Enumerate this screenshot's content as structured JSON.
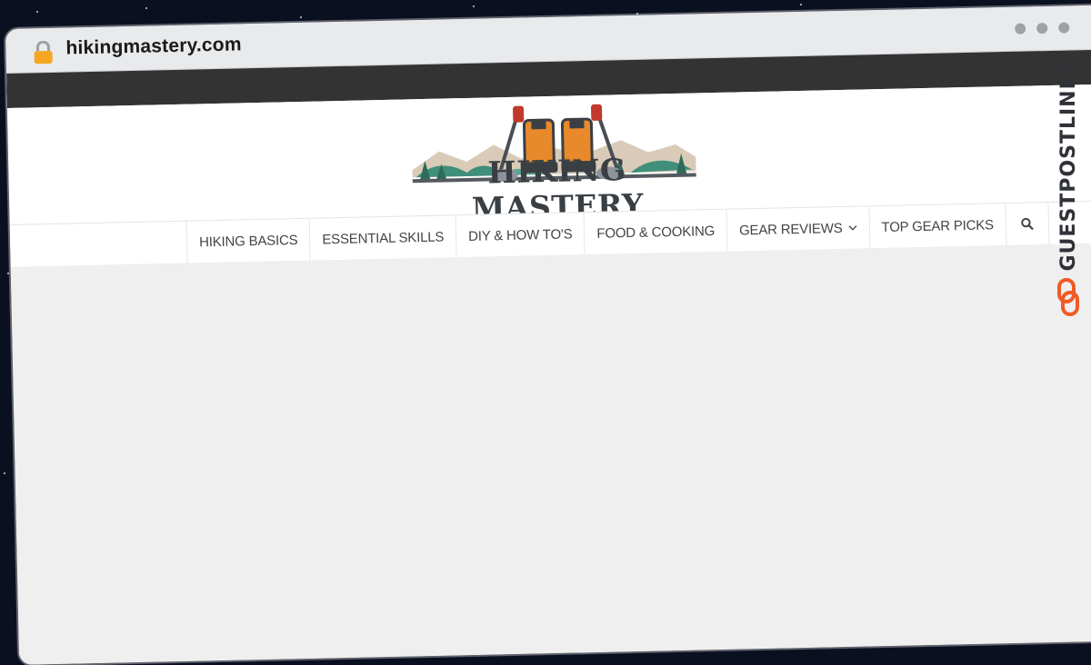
{
  "browser": {
    "url": "hikingmastery.com"
  },
  "site": {
    "logo_text": "HIKING MASTERY"
  },
  "nav": {
    "items": [
      {
        "label": "HIKING BASICS"
      },
      {
        "label": "ESSENTIAL SKILLS"
      },
      {
        "label": "DIY & HOW TO'S"
      },
      {
        "label": "FOOD & COOKING"
      },
      {
        "label": "GEAR REVIEWS"
      },
      {
        "label": "TOP GEAR PICKS"
      }
    ],
    "search_icon": "search-icon"
  },
  "badge": {
    "text": "GUESTPOSTLINKS",
    "color": "#f15a24"
  },
  "colors": {
    "topbar": "#333333",
    "content_bg": "#efefef",
    "accent_orange": "#e8892b"
  }
}
